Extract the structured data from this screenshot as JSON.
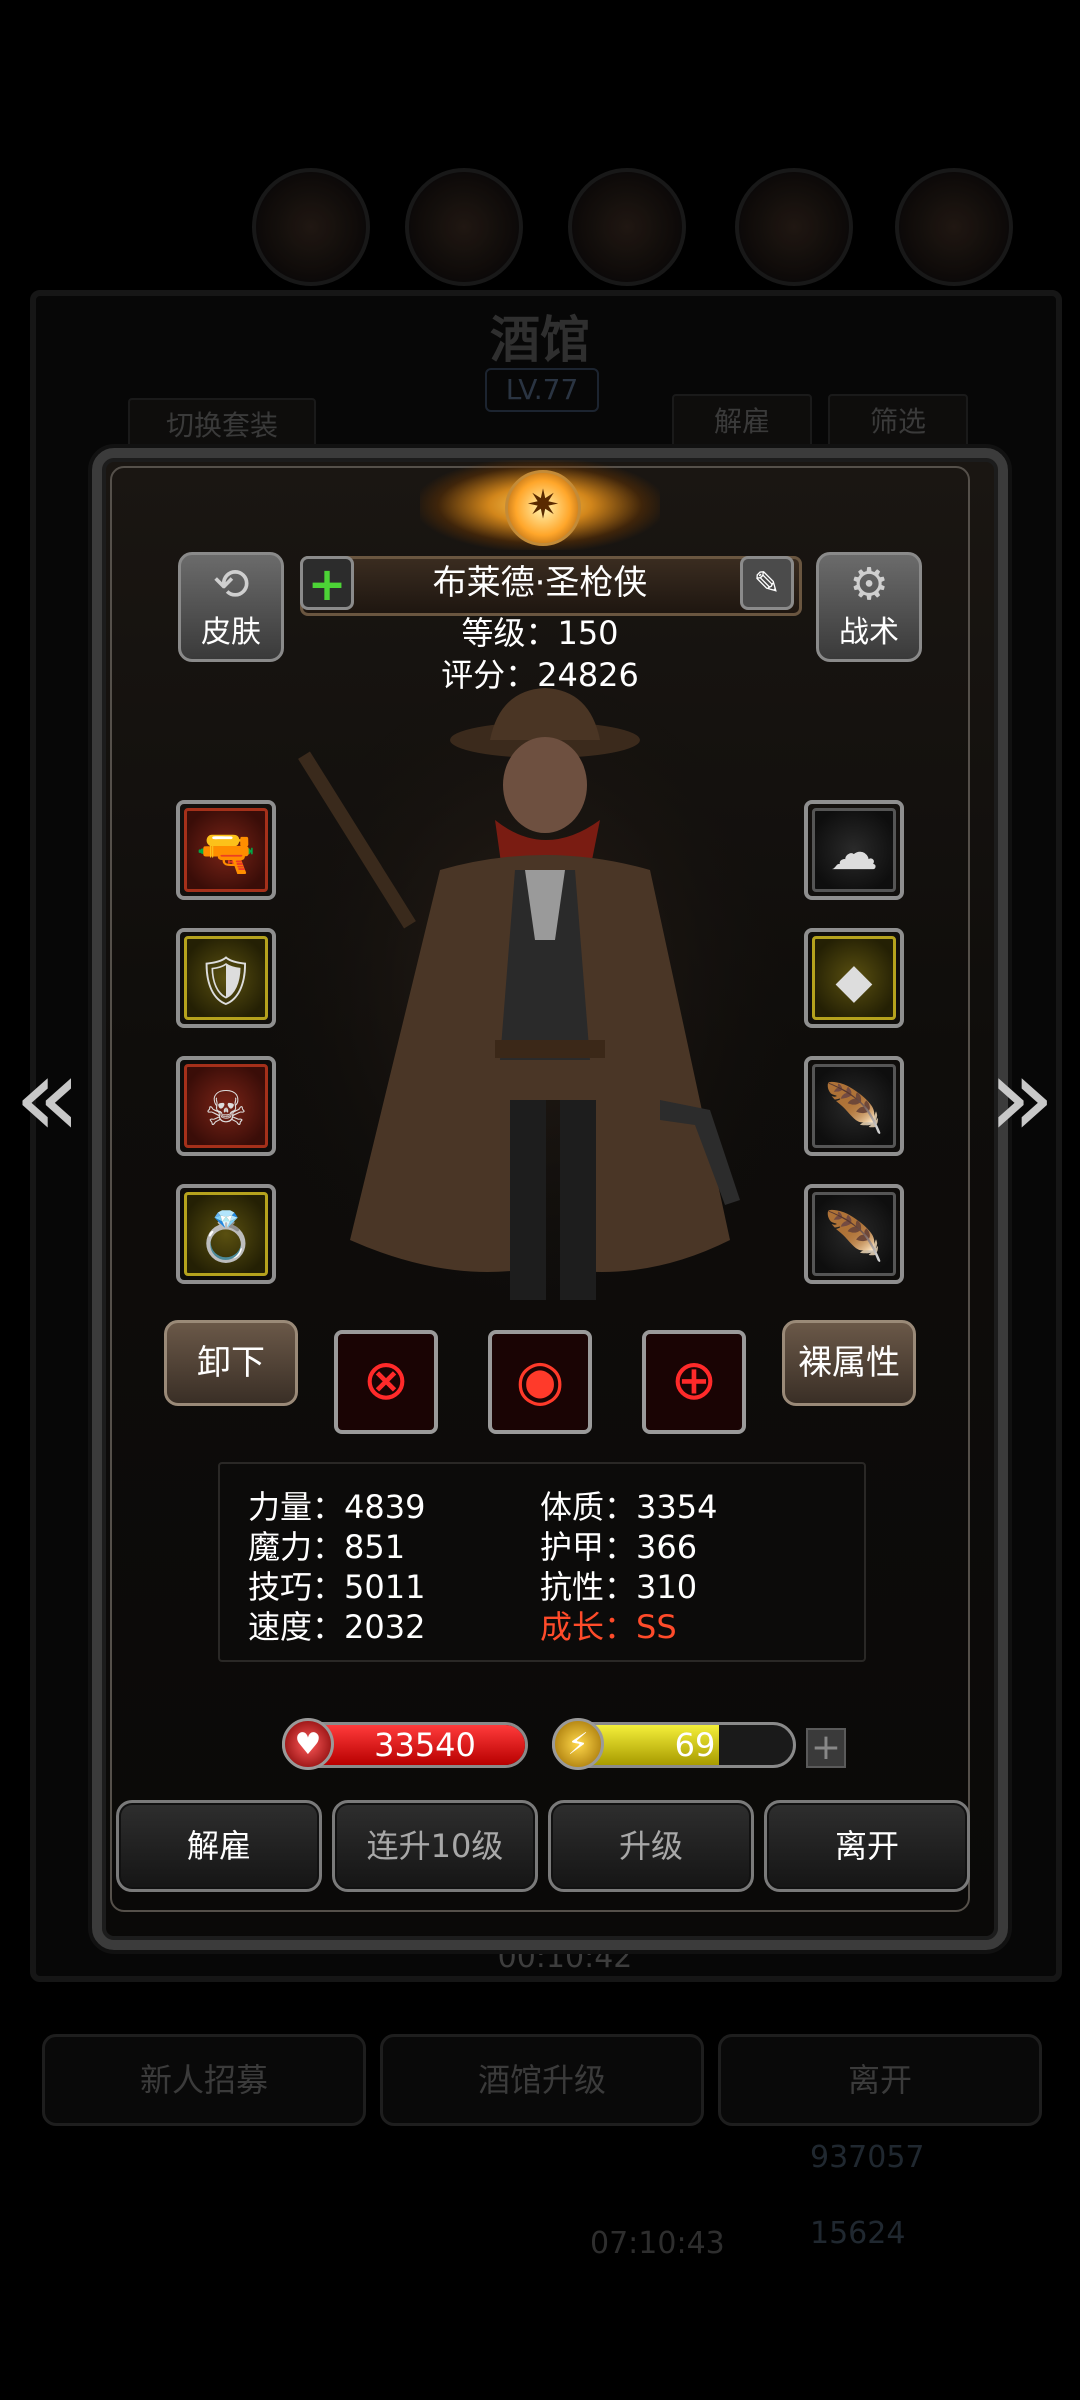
{
  "background": {
    "title": "酒馆",
    "level": "LV.77",
    "tabs": {
      "switch_outfit": "切换套装",
      "dismiss": "解雇",
      "filter": "筛选"
    },
    "timer_top": "00:10:42",
    "bottom_buttons": [
      "新人招募",
      "酒馆升级",
      "离开"
    ],
    "gold": "937057",
    "gems": "15624",
    "timer_bottom": "07:10:43"
  },
  "hero": {
    "name": "布莱德·圣枪侠",
    "level_line": "等级：150",
    "score_line": "评分：24826",
    "skin_label": "皮肤",
    "tactics_label": "战术",
    "unequip_label": "卸下",
    "bare_attr_label": "裸属性"
  },
  "equipment": {
    "left": [
      {
        "icon": "rifle-icon",
        "rarity": "red"
      },
      {
        "icon": "armor-icon",
        "rarity": "gold"
      },
      {
        "icon": "demon-helm-icon",
        "rarity": "red"
      },
      {
        "icon": "ring-icon",
        "rarity": "gold"
      }
    ],
    "right": [
      {
        "icon": "cloud-amulet-icon",
        "rarity": "plain"
      },
      {
        "icon": "green-gem-icon",
        "rarity": "gold"
      },
      {
        "icon": "feather-icon",
        "rarity": "plain"
      },
      {
        "icon": "feather-icon",
        "rarity": "plain"
      }
    ]
  },
  "skills": [
    "crosshair-skill-icon",
    "vortex-skill-icon",
    "target-skill-icon"
  ],
  "attributes": {
    "strength": "力量：4839",
    "magic": "魔力：851",
    "skill": "技巧：5011",
    "speed": "速度：2032",
    "constitution": "体质：3354",
    "armor": "护甲：366",
    "resistance": "抗性：310",
    "growth": "成长：SS"
  },
  "bars": {
    "hp": "33540",
    "hp_fill": 1.0,
    "energy": "69",
    "energy_fill": 0.69
  },
  "actions": {
    "dismiss": "解雇",
    "level_up_10": "连升10级",
    "level_up": "升级",
    "leave": "离开"
  },
  "colors": {
    "growth_text": "#ff4b2a",
    "hp_bar": "#d01010",
    "energy_bar": "#e8e030",
    "plus_green": "#4cd336"
  }
}
